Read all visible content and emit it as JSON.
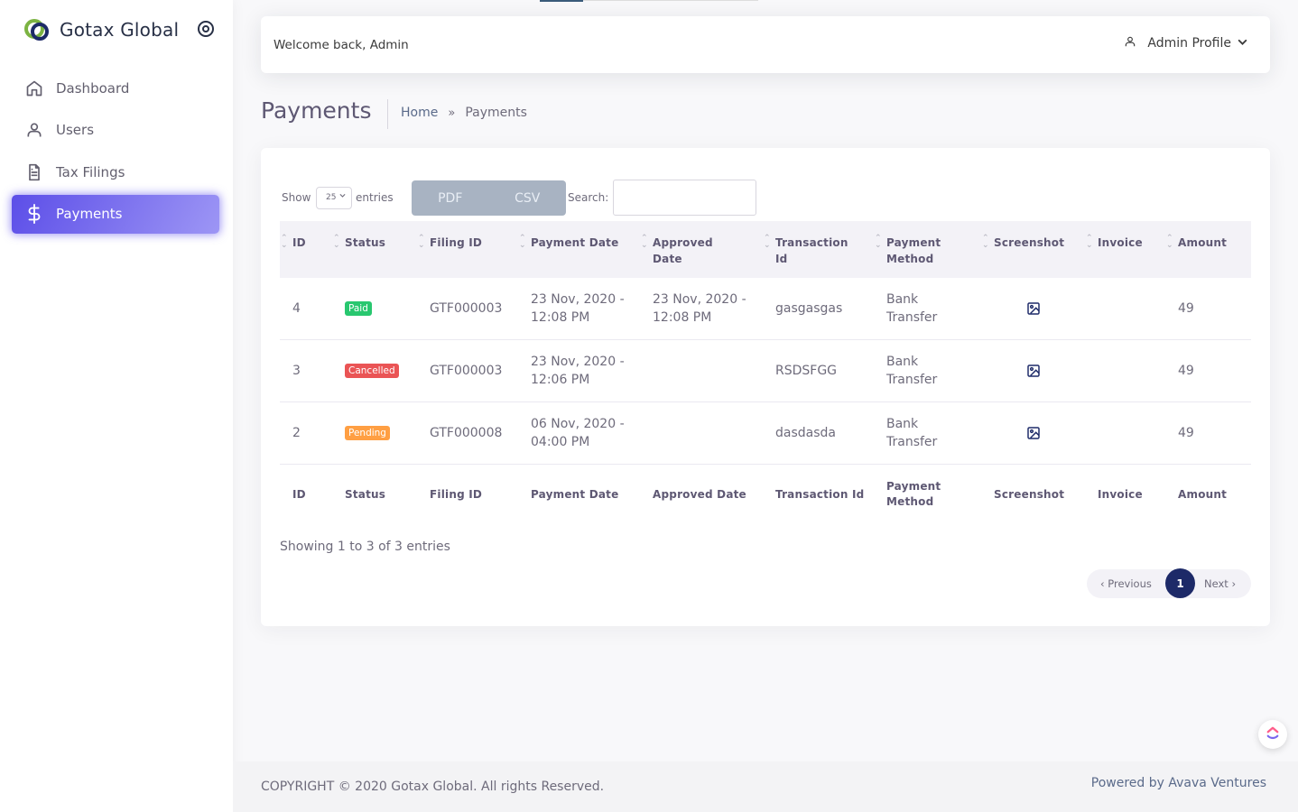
{
  "brand": {
    "name": "Gotax Global"
  },
  "sidebar": {
    "items": [
      {
        "label": "Dashboard",
        "icon": "home-icon"
      },
      {
        "label": "Users",
        "icon": "user-icon"
      },
      {
        "label": "Tax Filings",
        "icon": "document-icon"
      },
      {
        "label": "Payments",
        "icon": "dollar-icon",
        "active": true
      }
    ]
  },
  "header": {
    "welcome": "Welcome back, Admin",
    "profile_label": "Admin Profile"
  },
  "page": {
    "title": "Payments",
    "breadcrumb": {
      "home": "Home",
      "separator": "»",
      "current": "Payments"
    }
  },
  "controls": {
    "show_label": "Show",
    "entries_value": "25",
    "entries_label": "entries",
    "pdf_label": "PDF",
    "csv_label": "CSV",
    "search_label": "Search:"
  },
  "table": {
    "columns": [
      "ID",
      "Status",
      "Filing ID",
      "Payment Date",
      "Approved Date",
      "Transaction Id",
      "Payment Method",
      "Screenshot",
      "Invoice",
      "Amount"
    ],
    "header_lines": {
      "approved": [
        "Approved",
        "Date"
      ],
      "transaction": [
        "Transaction",
        "Id"
      ],
      "method": [
        "Payment",
        "Method"
      ]
    },
    "rows": [
      {
        "id": "4",
        "status": "Paid",
        "filing_id": "GTF000003",
        "payment_date": [
          "23 Nov, 2020 -",
          "12:08 PM"
        ],
        "approved_date": [
          "23 Nov, 2020 -",
          "12:08 PM"
        ],
        "transaction_id": "gasgasgas",
        "method": [
          "Bank",
          "Transfer"
        ],
        "amount": "49"
      },
      {
        "id": "3",
        "status": "Cancelled",
        "filing_id": "GTF000003",
        "payment_date": [
          "23 Nov, 2020 -",
          "12:06 PM"
        ],
        "approved_date": [
          "",
          ""
        ],
        "transaction_id": "RSDSFGG",
        "method": [
          "Bank",
          "Transfer"
        ],
        "amount": "49"
      },
      {
        "id": "2",
        "status": "Pending",
        "filing_id": "GTF000008",
        "payment_date": [
          "06 Nov, 2020 -",
          "04:00 PM"
        ],
        "approved_date": [
          "",
          ""
        ],
        "transaction_id": "dasdasda",
        "method": [
          "Bank",
          "Transfer"
        ],
        "amount": "49"
      }
    ]
  },
  "pagination": {
    "info": "Showing 1 to 3 of 3 entries",
    "prev": "‹ Previous",
    "current": "1",
    "next": "Next ›"
  },
  "footer": {
    "copyright": "COPYRIGHT © 2020 Gotax Global. All rights Reserved.",
    "powered": "Powered by Avava Ventures"
  },
  "colors": {
    "primary": "#7367f0",
    "paid": "#28c76f",
    "cancelled": "#ea5455",
    "pending": "#ff9f43",
    "pager_active": "#1d2a68"
  }
}
